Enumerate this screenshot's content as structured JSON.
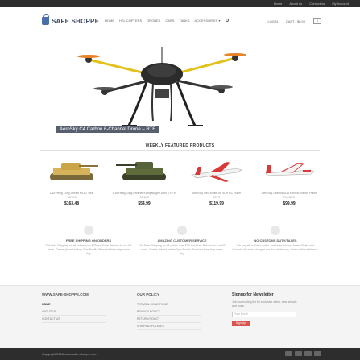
{
  "topbar": {
    "links": [
      "Home",
      "About us",
      "Contact us",
      "My Account"
    ]
  },
  "header": {
    "logo": "SAFE SHOPPE",
    "nav": [
      "Home",
      "Helicopters",
      "Drones",
      "Cars",
      "Tanks",
      "Accessories ▾"
    ],
    "login": "Login",
    "cart": "Cart / $0.00",
    "cart_count": "0"
  },
  "hero": {
    "caption": "AeroSky C4 Carbon 6-Channel Drone – RTF"
  },
  "section_title": "WEEKLY FEATURED PRODUCTS",
  "products": [
    {
      "name": "1/16 Heng Long Desert M1A2 Tank",
      "sub": "TANKS",
      "price": "$163.48"
    },
    {
      "name": "1/16 Heng Long Panther Kampfwagen Ausf G RTR",
      "sub": "TANKS",
      "price": "$54.99"
    },
    {
      "name": "AeroSky Red White Jet 4CH RC Plane",
      "sub": "JETS",
      "price": "$119.99"
    },
    {
      "name": "AeroSky Cessna 4CH Electric Trainer Plane",
      "sub": "PLANES",
      "price": "$99.99"
    }
  ],
  "features": [
    {
      "title": "Free Shipping on Orders",
      "desc": "Get Free Shipping on all orders over $75 and Free Returns to our US store. Orders placed before 3pm Pacific Standard time ship same day."
    },
    {
      "title": "Amazing Customer Service",
      "desc": "Get Free Shipping on all orders over $75 and Free Returns to our US store. Orders placed before 3pm Pacific Standard time ship same day."
    },
    {
      "title": "No Customs Duty/Taxes",
      "desc": "We pay all customs duties and taxes for the United States and Canada. No extra charges are due at delivery. Order with confidence."
    }
  ],
  "footer": {
    "col1": {
      "heading": "WWW.SAFE-SHOPPE.COM",
      "items": [
        "Home",
        "About Us",
        "Contact Us"
      ]
    },
    "col2": {
      "heading": "Our Policy",
      "items": [
        "Terms & Conditions",
        "Privacy Policy",
        "Return Policy",
        "Shipping Policies"
      ]
    },
    "news": {
      "heading": "Signup for Newsletter",
      "desc": "Join our mailing list for exclusive offers, new arrivals and more.",
      "placeholder": "Your Email",
      "button": "Sign Up"
    }
  },
  "copyright": "Copyright 2016 www.safe-shoppe.com"
}
